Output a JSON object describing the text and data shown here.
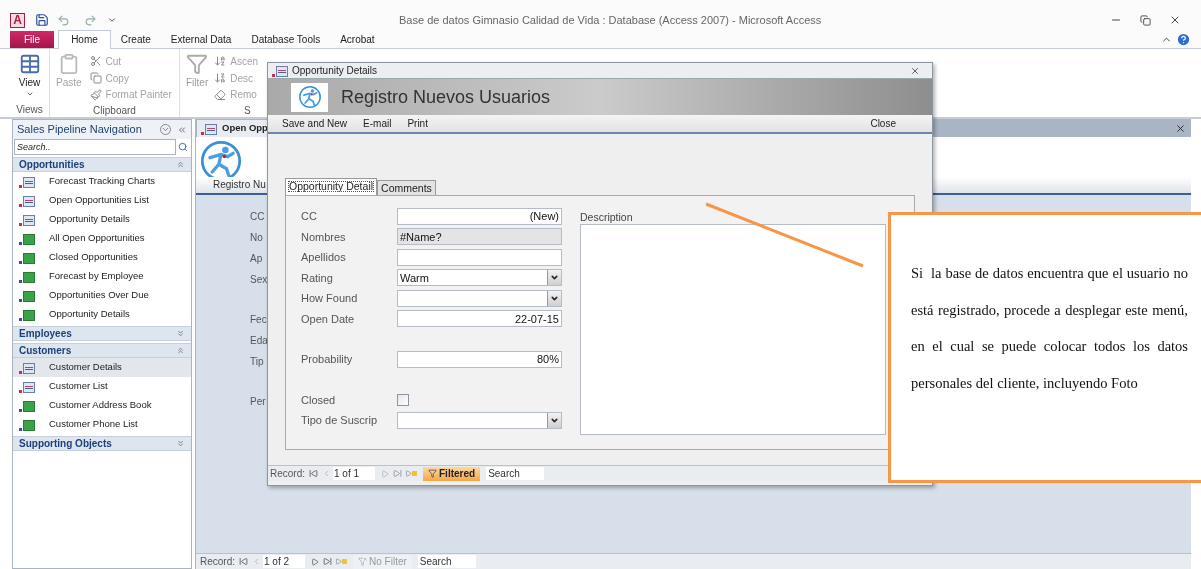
{
  "window": {
    "app_icon_letter": "A",
    "title": "Base de datos Gimnasio Calidad de Vida : Database (Access 2007)  -  Microsoft Access"
  },
  "ribbon_tabs": [
    {
      "label": "File",
      "kind": "file",
      "selected": false
    },
    {
      "label": "Home",
      "kind": "tab",
      "selected": true
    },
    {
      "label": "Create",
      "kind": "tab",
      "selected": false
    },
    {
      "label": "External Data",
      "kind": "tab",
      "selected": false
    },
    {
      "label": "Database Tools",
      "kind": "tab",
      "selected": false
    },
    {
      "label": "Acrobat",
      "kind": "tab",
      "selected": false
    }
  ],
  "ribbon": {
    "views": {
      "label": "Views",
      "button": {
        "label": "View",
        "disabled": false
      }
    },
    "clipboard": {
      "label": "Clipboard",
      "paste": {
        "label": "Paste",
        "disabled": true
      },
      "items": [
        {
          "label": "Cut",
          "disabled": true
        },
        {
          "label": "Copy",
          "disabled": true
        },
        {
          "label": "Format Painter",
          "disabled": true
        }
      ]
    },
    "sort": {
      "label": "S",
      "filter": {
        "label": "Filter",
        "disabled": true
      },
      "items": [
        {
          "label": "Ascen",
          "disabled": true
        },
        {
          "label": "Desc",
          "disabled": true
        },
        {
          "label": "Remo",
          "disabled": true
        }
      ]
    }
  },
  "navigation": {
    "title": "Sales Pipeline Navigation",
    "search_placeholder": "Search..",
    "groups": [
      {
        "label": "Opportunities",
        "expanded": true,
        "items": [
          {
            "label": "Forecast Tracking Charts",
            "kind": "form",
            "selected": false
          },
          {
            "label": "Open Opportunities List",
            "kind": "form",
            "selected": false
          },
          {
            "label": "Opportunity Details",
            "kind": "form",
            "selected": false
          },
          {
            "label": "All Open Opportunities",
            "kind": "report",
            "selected": false
          },
          {
            "label": "Closed Opportunities",
            "kind": "report",
            "selected": false
          },
          {
            "label": "Forecast by Employee",
            "kind": "report",
            "selected": false
          },
          {
            "label": "Opportunities Over Due",
            "kind": "report",
            "selected": false
          },
          {
            "label": "Opportunity Details",
            "kind": "report",
            "selected": false
          }
        ]
      },
      {
        "label": "Employees",
        "expanded": false
      },
      {
        "label": "Customers",
        "expanded": true,
        "items": [
          {
            "label": "Customer Details",
            "kind": "form",
            "selected": true
          },
          {
            "label": "Customer List",
            "kind": "form",
            "selected": false
          },
          {
            "label": "Customer Address Book",
            "kind": "report",
            "selected": false
          },
          {
            "label": "Customer Phone List",
            "kind": "report",
            "selected": false
          }
        ]
      },
      {
        "label": "Supporting Objects",
        "expanded": false
      }
    ]
  },
  "document": {
    "tab": "Open Opp",
    "header": "Registro Nu",
    "label_groups": [
      [
        "CC",
        "No",
        "Ap",
        "Sex"
      ],
      [
        "Fec",
        "Eda",
        "Tip"
      ],
      [
        "Per"
      ]
    ],
    "record_bar": {
      "label": "Record:",
      "position": "1 of 2",
      "filter": "No Filter",
      "filter_active": false,
      "search": "Search"
    }
  },
  "popup": {
    "title": "Opportunity Details",
    "header": "Registro Nuevos Usuarios",
    "toolbar": [
      {
        "label": "Save and New"
      },
      {
        "label": "E-mail"
      },
      {
        "label": "Print"
      },
      {
        "label": "Close"
      }
    ],
    "tabs": [
      {
        "label": "Opportunity Detail",
        "selected": true
      },
      {
        "label": "Comments",
        "selected": false
      }
    ],
    "field_groups": [
      [
        {
          "label": "CC",
          "kind": "text",
          "value": "(New)"
        },
        {
          "label": "Nombres",
          "kind": "readonly",
          "value": "#Name?"
        },
        {
          "label": "Apellidos",
          "kind": "text"
        },
        {
          "label": "Rating",
          "kind": "combo",
          "value": "Warm"
        },
        {
          "label": "How Found",
          "kind": "combo"
        },
        {
          "label": "Open Date",
          "kind": "text",
          "value": "22-07-15"
        }
      ],
      [
        {
          "label": "Probability",
          "kind": "text",
          "value": "80%"
        }
      ],
      [
        {
          "label": "Closed",
          "kind": "checkbox",
          "checked": false
        },
        {
          "label": "Tipo de Suscrip",
          "kind": "combo"
        }
      ]
    ],
    "description_label": "Description",
    "record_bar": {
      "label": "Record:",
      "position": "1 of 1",
      "filter": "Filtered",
      "filter_active": true,
      "search": "Search"
    }
  },
  "callout": {
    "text": "Si  la base de datos encuentra que el usuario no está registrado, procede a desplegar este menú, en el cual se puede colocar todos los datos personales del cliente, incluyendo Foto"
  }
}
